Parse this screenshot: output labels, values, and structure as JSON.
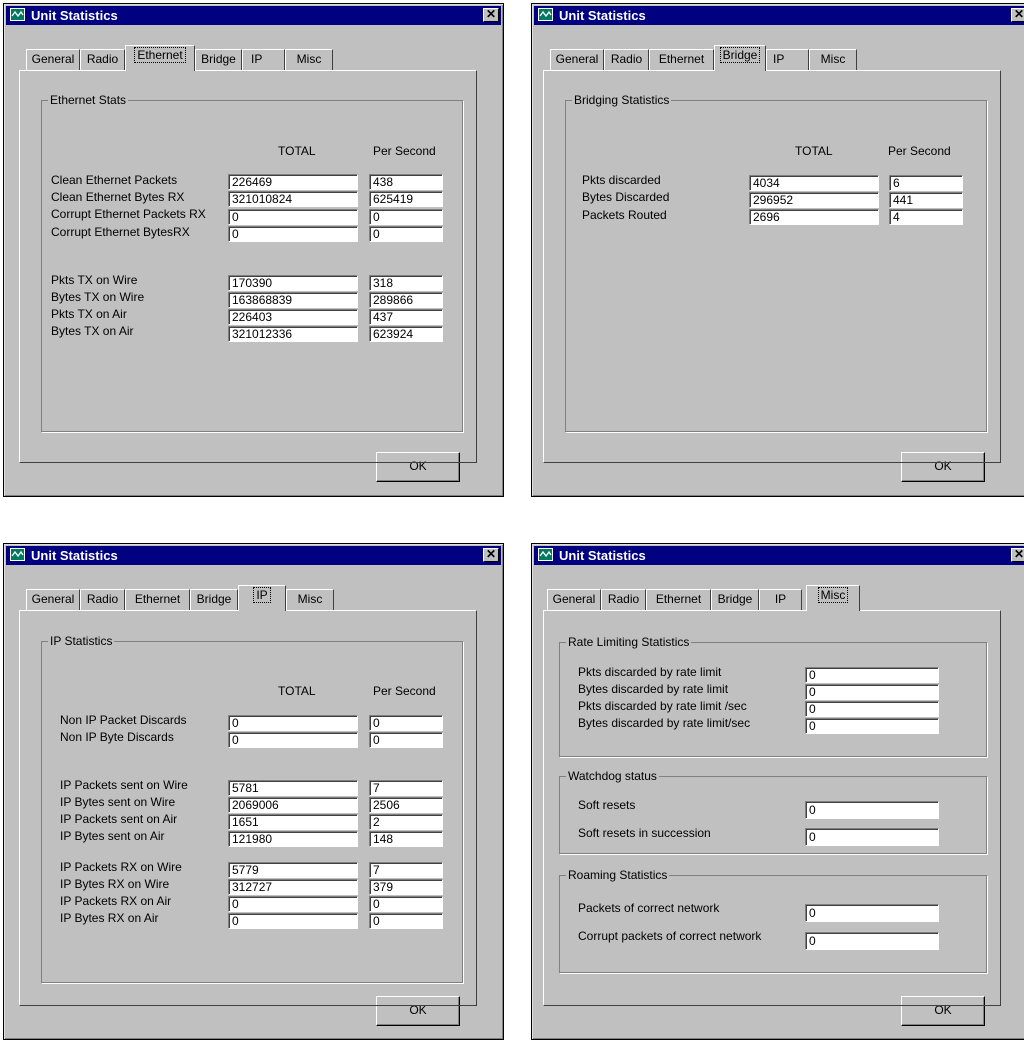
{
  "window_title": "Unit Statistics",
  "tabs": [
    "General",
    "Radio",
    "Ethernet",
    "Bridge",
    "IP",
    "Misc"
  ],
  "ok_label": "OK",
  "close_glyph": "✕",
  "col_total": "TOTAL",
  "col_per_second": "Per Second",
  "ethernet": {
    "group_title": "Ethernet Stats",
    "rows1": [
      {
        "label": "Clean Ethernet Packets",
        "total": "226469",
        "per_second": "438"
      },
      {
        "label": "Clean Ethernet Bytes RX",
        "total": "321010824",
        "per_second": "625419"
      },
      {
        "label": "Corrupt Ethernet Packets RX",
        "total": "0",
        "per_second": "0"
      },
      {
        "label": "Corrupt Ethernet BytesRX",
        "total": "0",
        "per_second": "0"
      }
    ],
    "rows2": [
      {
        "label": "Pkts TX on Wire",
        "total": "170390",
        "per_second": "318"
      },
      {
        "label": "Bytes TX on Wire",
        "total": "163868839",
        "per_second": "289866"
      },
      {
        "label": "Pkts TX on Air",
        "total": "226403",
        "per_second": "437"
      },
      {
        "label": "Bytes TX on Air",
        "total": "321012336",
        "per_second": "623924"
      }
    ]
  },
  "bridge": {
    "group_title": "Bridging Statistics",
    "rows": [
      {
        "label": "Pkts discarded",
        "total": "4034",
        "per_second": "6"
      },
      {
        "label": "Bytes Discarded",
        "total": "296952",
        "per_second": "441"
      },
      {
        "label": "Packets Routed",
        "total": "2696",
        "per_second": "4"
      }
    ]
  },
  "ip": {
    "group_title": "IP Statistics",
    "rows1": [
      {
        "label": "Non IP Packet Discards",
        "total": "0",
        "per_second": "0"
      },
      {
        "label": "Non IP Byte Discards",
        "total": "0",
        "per_second": "0"
      }
    ],
    "rows2": [
      {
        "label": "IP Packets sent on Wire",
        "total": "5781",
        "per_second": "7"
      },
      {
        "label": "IP Bytes sent on Wire",
        "total": "2069006",
        "per_second": "2506"
      },
      {
        "label": "IP Packets sent on Air",
        "total": "1651",
        "per_second": "2"
      },
      {
        "label": "IP Bytes sent on Air",
        "total": "121980",
        "per_second": "148"
      }
    ],
    "rows3": [
      {
        "label": "IP Packets RX on Wire",
        "total": "5779",
        "per_second": "7"
      },
      {
        "label": "IP Bytes RX on Wire",
        "total": "312727",
        "per_second": "379"
      },
      {
        "label": "IP Packets RX on Air",
        "total": "0",
        "per_second": "0"
      },
      {
        "label": "IP Bytes RX on Air",
        "total": "0",
        "per_second": "0"
      }
    ]
  },
  "misc": {
    "rate_title": "Rate Limiting Statistics",
    "rate_rows": [
      {
        "label": "Pkts discarded by rate limit",
        "value": "0"
      },
      {
        "label": "Bytes discarded by rate limit",
        "value": "0"
      },
      {
        "label": "Pkts discarded by rate limit /sec",
        "value": "0"
      },
      {
        "label": "Bytes discarded by rate limit/sec",
        "value": "0"
      }
    ],
    "watchdog_title": "Watchdog status",
    "watchdog_rows": [
      {
        "label": "Soft resets",
        "value": "0"
      },
      {
        "label": "Soft resets in succession",
        "value": "0"
      }
    ],
    "roaming_title": "Roaming Statistics",
    "roaming_rows": [
      {
        "label": "Packets of correct network",
        "value": "0"
      },
      {
        "label": "Corrupt packets of correct network",
        "value": "0"
      }
    ]
  }
}
